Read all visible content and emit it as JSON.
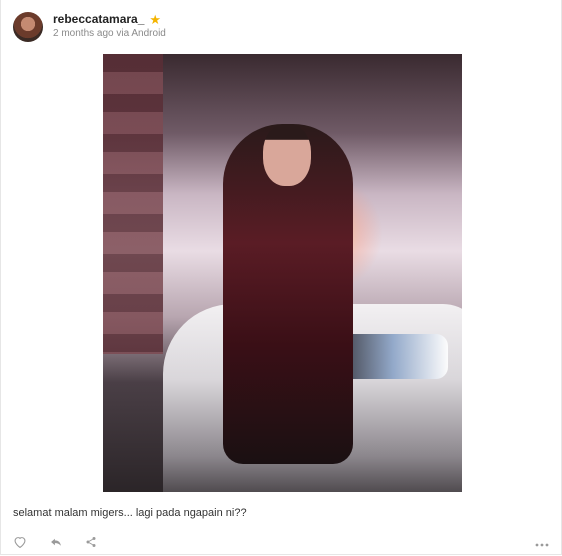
{
  "post": {
    "username": "rebeccatamara_",
    "meta": "2 months ago via Android",
    "caption": "selamat malam migers... lagi pada ngapain ni??"
  },
  "icons": {
    "verified": "star-icon",
    "like": "heart-icon",
    "reply": "reply-icon",
    "share": "share-icon",
    "more": "more-icon"
  },
  "colors": {
    "star": "#f4b400",
    "action_icons": "#9a9a9a"
  }
}
